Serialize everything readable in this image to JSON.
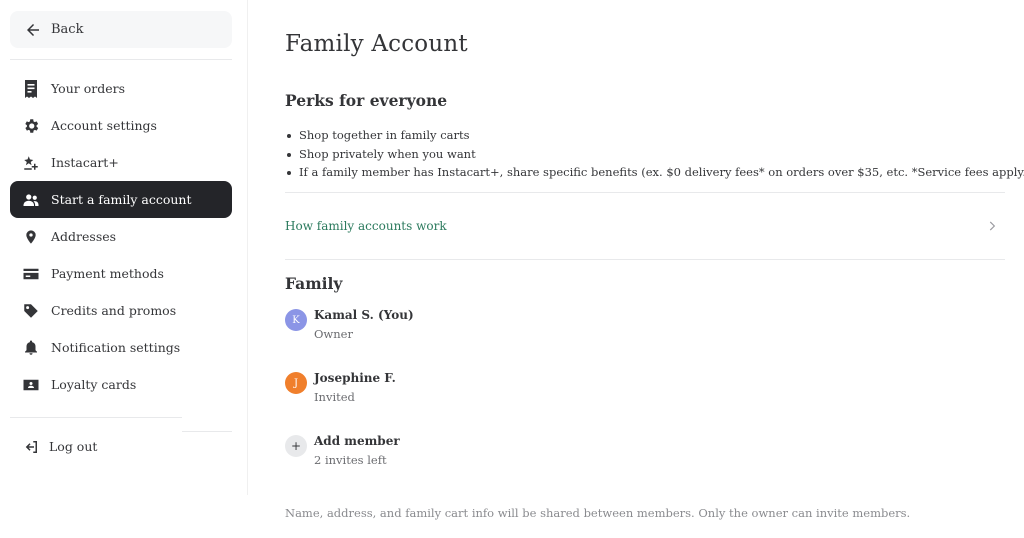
{
  "sidebar": {
    "back_label": "Back",
    "items": [
      {
        "label": "Your orders",
        "icon": "receipt-icon"
      },
      {
        "label": "Account settings",
        "icon": "gear-icon"
      },
      {
        "label": "Instacart+",
        "icon": "instacart-plus-icon"
      },
      {
        "label": "Start a family account",
        "icon": "family-icon",
        "active": true
      },
      {
        "label": "Addresses",
        "icon": "location-pin-icon"
      },
      {
        "label": "Payment methods",
        "icon": "credit-card-icon"
      },
      {
        "label": "Credits and promos",
        "icon": "tag-icon"
      },
      {
        "label": "Notification settings",
        "icon": "bell-icon"
      },
      {
        "label": "Loyalty cards",
        "icon": "id-card-icon"
      }
    ],
    "logout_label": "Log out"
  },
  "main": {
    "title": "Family Account",
    "perks_title": "Perks for everyone",
    "perks": [
      "Shop together in family carts",
      "Shop privately when you want",
      "If a family member has Instacart+, share specific benefits (ex. $0 delivery fees* on orders over $35, etc. *Service fees apply.)"
    ],
    "how_link": "How family accounts work",
    "family_title": "Family",
    "members": [
      {
        "initial": "K",
        "name": "Kamal S. (You)",
        "role": "Owner",
        "color": "#8b95e6"
      },
      {
        "initial": "J",
        "name": "Josephine F.",
        "role": "Invited",
        "color": "#f07f2c"
      }
    ],
    "add_member": {
      "symbol": "+",
      "label": "Add member",
      "sub": "2 invites left"
    },
    "footnote": "Name, address, and family cart info will be shared between members. Only the owner can invite members."
  },
  "colors": {
    "link": "#2b7a5d",
    "active_bg": "#242529",
    "back_bg": "#f6f7f8"
  }
}
